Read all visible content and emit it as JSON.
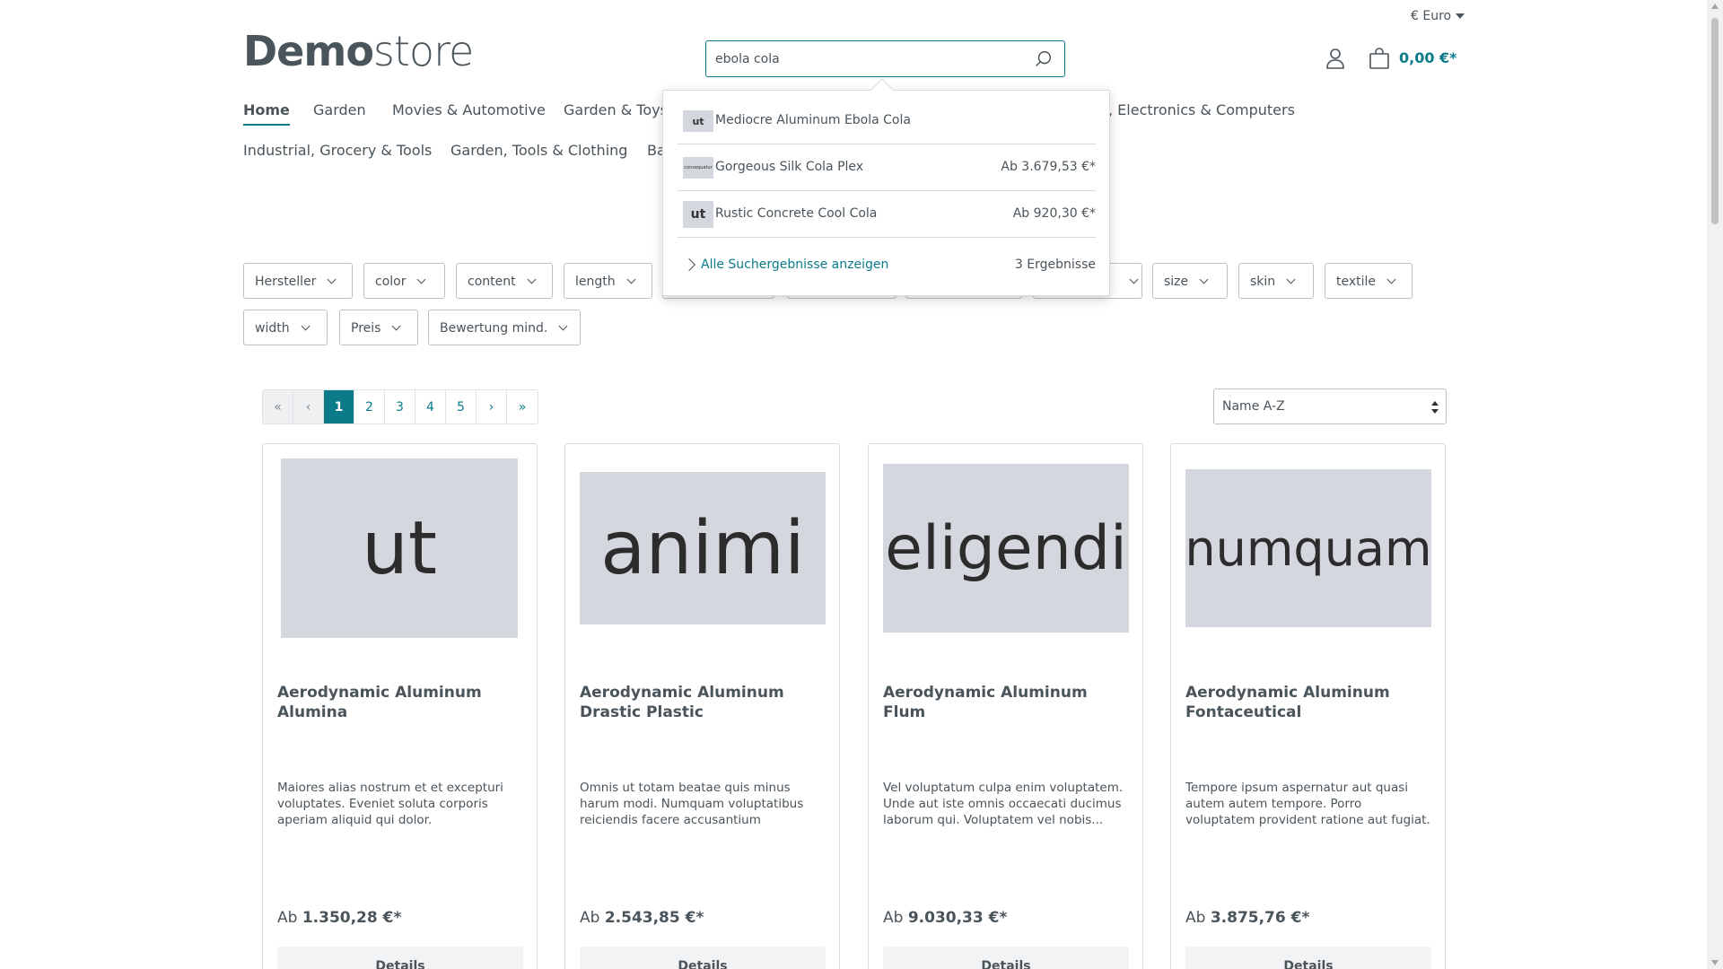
{
  "header": {
    "currency": "€ Euro",
    "logo_bold": "Demo",
    "logo_light": "store",
    "search_value": "ebola cola",
    "cart_total": "0,00 €*"
  },
  "nav": {
    "items": [
      "Home",
      "Garden",
      "Movies & Automotive",
      "Garden & Toys",
      "Ba",
      ", Electronics & Computers",
      "Industrial, Grocery & Tools",
      "Garden, Tools & Clothing"
    ]
  },
  "filters": {
    "items": [
      "Hersteller",
      "color",
      "content",
      "length",
      "size",
      "skin",
      "textile",
      "width",
      "Preis",
      "Bewertung mind."
    ]
  },
  "pagination": {
    "first": "«",
    "prev": "‹",
    "pages": [
      "1",
      "2",
      "3",
      "4",
      "5"
    ],
    "next": "›",
    "last": "»"
  },
  "sort": {
    "selected": "Name A-Z"
  },
  "products": [
    {
      "image_text": "ut",
      "name": "Aerodynamic Aluminum Alumina",
      "description": "Maiores alias nostrum et et excepturi voluptates. Eveniet soluta corporis aperiam aliquid qui dolor. Necessitatibu...",
      "price_prefix": "Ab ",
      "price": "1.350,28 €*",
      "button": "Details"
    },
    {
      "image_text": "animi",
      "name": "Aerodynamic Aluminum Drastic Plastic",
      "description": "Omnis ut totam beatae quis minus harum modi. Numquam voluptatibus reiciendis facere accusantium temporibus. Et...",
      "price_prefix": "Ab ",
      "price": "2.543,85 €*",
      "button": "Details"
    },
    {
      "image_text": "eligendi",
      "name": "Aerodynamic Aluminum Flum",
      "description": "Vel voluptatum culpa enim voluptatem. Unde aut iste omnis occaecati ducimus laborum qui. Voluptatem vel nobis...",
      "price_prefix": "Ab ",
      "price": "9.030,33 €*",
      "button": "Details"
    },
    {
      "image_text": "numquam",
      "name": "Aerodynamic Aluminum Fontaceutical",
      "description": "Tempore ipsum aspernatur aut quasi autem autem tempore. Porro voluptatem provident ratione aut fugiat. Voluptates...",
      "price_prefix": "Ab ",
      "price": "3.875,76 €*",
      "button": "Details"
    }
  ],
  "suggestions": {
    "items": [
      {
        "thumb": "ut",
        "name": "Mediocre Aluminum Ebola Cola",
        "price": ""
      },
      {
        "thumb": "consequatur",
        "name": "Gorgeous Silk Cola Plex",
        "price": "Ab 3.679,53 €*"
      },
      {
        "thumb": "ut",
        "name": "Rustic Concrete Cool Cola",
        "price": "Ab 920,30 €*"
      }
    ],
    "all_results": "Alle Suchergebnisse anzeigen",
    "count": "3 Ergebnisse"
  },
  "colors": {
    "accent": "#0b7b8a",
    "text": "#4a545b",
    "placeholder_bg": "#d4d7de"
  }
}
